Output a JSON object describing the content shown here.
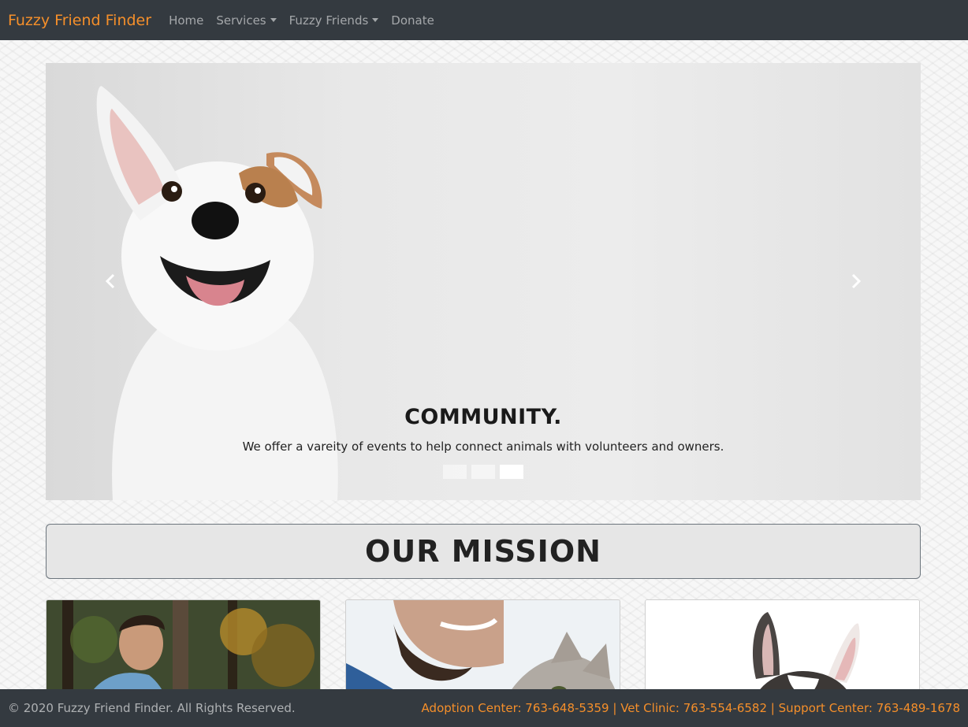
{
  "navbar": {
    "brand": "Fuzzy Friend Finder",
    "links": [
      {
        "label": "Home"
      },
      {
        "label": "Services"
      },
      {
        "label": "Fuzzy Friends"
      },
      {
        "label": "Donate"
      }
    ]
  },
  "carousel": {
    "slide": {
      "title": "COMMUNITY.",
      "text": "We offer a vareity of events to help connect animals with volunteers and owners."
    },
    "indicators": 3,
    "active_index": 2
  },
  "mission": {
    "heading": "OUR MISSION"
  },
  "footer": {
    "copyright": "© 2020 Fuzzy Friend Finder. All Rights Reserved.",
    "adoption": "Adoption Center: 763-648-5359",
    "vet": "Vet Clinic: 763-554-6582",
    "support": "Support Center: 763-489-1678",
    "separator": "|"
  },
  "colors": {
    "brand": "#f58f2a",
    "navbar_bg": "#343a40"
  }
}
